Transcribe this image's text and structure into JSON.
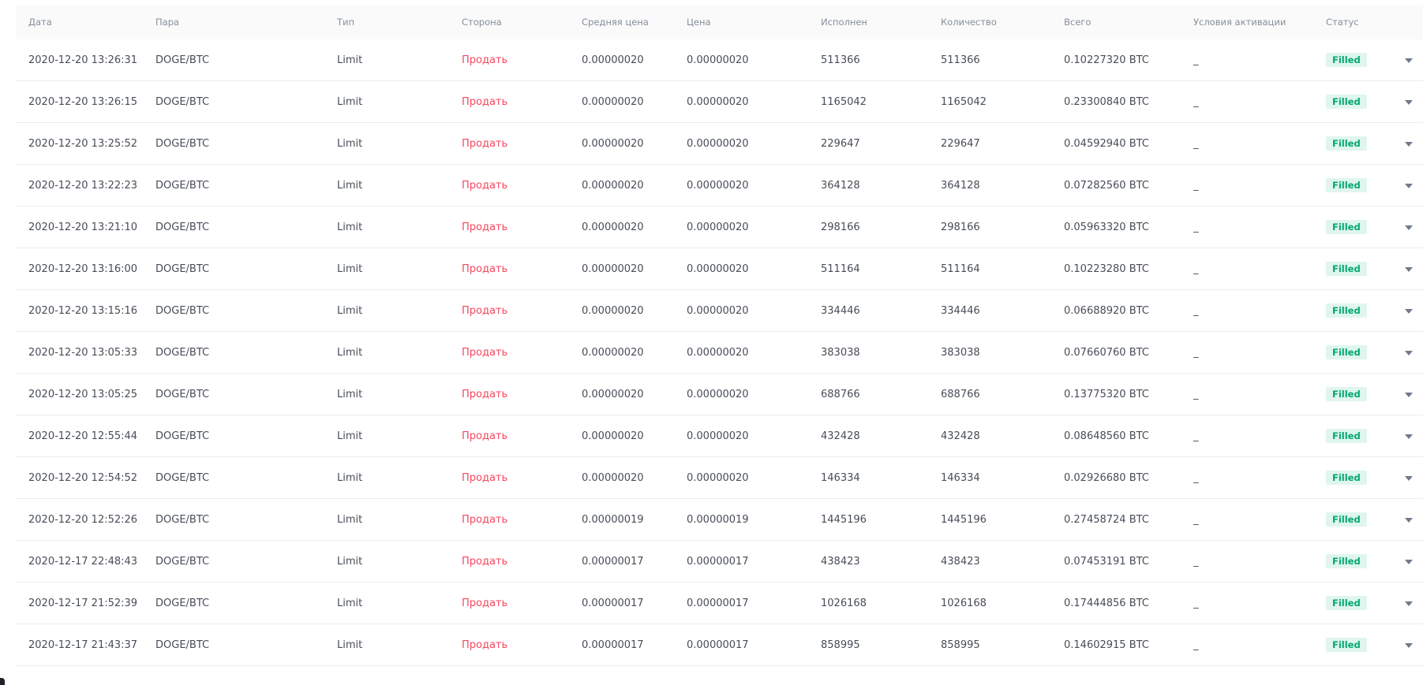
{
  "table": {
    "headers": [
      "Дата",
      "Пара",
      "Тип",
      "Сторона",
      "Средняя цена",
      "Цена",
      "Исполнен",
      "Количество",
      "Всего",
      "Условия активации",
      "Статус"
    ],
    "rows": [
      {
        "date": "2020-12-20 13:26:31",
        "pair": "DOGE/BTC",
        "type": "Limit",
        "side": "Продать",
        "avg_price": "0.00000020",
        "price": "0.00000020",
        "filled": "511366",
        "amount": "511366",
        "total": "0.10227320 BTC",
        "condition": "_",
        "status": "Filled"
      },
      {
        "date": "2020-12-20 13:26:15",
        "pair": "DOGE/BTC",
        "type": "Limit",
        "side": "Продать",
        "avg_price": "0.00000020",
        "price": "0.00000020",
        "filled": "1165042",
        "amount": "1165042",
        "total": "0.23300840 BTC",
        "condition": "_",
        "status": "Filled"
      },
      {
        "date": "2020-12-20 13:25:52",
        "pair": "DOGE/BTC",
        "type": "Limit",
        "side": "Продать",
        "avg_price": "0.00000020",
        "price": "0.00000020",
        "filled": "229647",
        "amount": "229647",
        "total": "0.04592940 BTC",
        "condition": "_",
        "status": "Filled"
      },
      {
        "date": "2020-12-20 13:22:23",
        "pair": "DOGE/BTC",
        "type": "Limit",
        "side": "Продать",
        "avg_price": "0.00000020",
        "price": "0.00000020",
        "filled": "364128",
        "amount": "364128",
        "total": "0.07282560 BTC",
        "condition": "_",
        "status": "Filled"
      },
      {
        "date": "2020-12-20 13:21:10",
        "pair": "DOGE/BTC",
        "type": "Limit",
        "side": "Продать",
        "avg_price": "0.00000020",
        "price": "0.00000020",
        "filled": "298166",
        "amount": "298166",
        "total": "0.05963320 BTC",
        "condition": "_",
        "status": "Filled"
      },
      {
        "date": "2020-12-20 13:16:00",
        "pair": "DOGE/BTC",
        "type": "Limit",
        "side": "Продать",
        "avg_price": "0.00000020",
        "price": "0.00000020",
        "filled": "511164",
        "amount": "511164",
        "total": "0.10223280 BTC",
        "condition": "_",
        "status": "Filled"
      },
      {
        "date": "2020-12-20 13:15:16",
        "pair": "DOGE/BTC",
        "type": "Limit",
        "side": "Продать",
        "avg_price": "0.00000020",
        "price": "0.00000020",
        "filled": "334446",
        "amount": "334446",
        "total": "0.06688920 BTC",
        "condition": "_",
        "status": "Filled"
      },
      {
        "date": "2020-12-20 13:05:33",
        "pair": "DOGE/BTC",
        "type": "Limit",
        "side": "Продать",
        "avg_price": "0.00000020",
        "price": "0.00000020",
        "filled": "383038",
        "amount": "383038",
        "total": "0.07660760 BTC",
        "condition": "_",
        "status": "Filled"
      },
      {
        "date": "2020-12-20 13:05:25",
        "pair": "DOGE/BTC",
        "type": "Limit",
        "side": "Продать",
        "avg_price": "0.00000020",
        "price": "0.00000020",
        "filled": "688766",
        "amount": "688766",
        "total": "0.13775320 BTC",
        "condition": "_",
        "status": "Filled"
      },
      {
        "date": "2020-12-20 12:55:44",
        "pair": "DOGE/BTC",
        "type": "Limit",
        "side": "Продать",
        "avg_price": "0.00000020",
        "price": "0.00000020",
        "filled": "432428",
        "amount": "432428",
        "total": "0.08648560 BTC",
        "condition": "_",
        "status": "Filled"
      },
      {
        "date": "2020-12-20 12:54:52",
        "pair": "DOGE/BTC",
        "type": "Limit",
        "side": "Продать",
        "avg_price": "0.00000020",
        "price": "0.00000020",
        "filled": "146334",
        "amount": "146334",
        "total": "0.02926680 BTC",
        "condition": "_",
        "status": "Filled"
      },
      {
        "date": "2020-12-20 12:52:26",
        "pair": "DOGE/BTC",
        "type": "Limit",
        "side": "Продать",
        "avg_price": "0.00000019",
        "price": "0.00000019",
        "filled": "1445196",
        "amount": "1445196",
        "total": "0.27458724 BTC",
        "condition": "_",
        "status": "Filled"
      },
      {
        "date": "2020-12-17 22:48:43",
        "pair": "DOGE/BTC",
        "type": "Limit",
        "side": "Продать",
        "avg_price": "0.00000017",
        "price": "0.00000017",
        "filled": "438423",
        "amount": "438423",
        "total": "0.07453191 BTC",
        "condition": "_",
        "status": "Filled"
      },
      {
        "date": "2020-12-17 21:52:39",
        "pair": "DOGE/BTC",
        "type": "Limit",
        "side": "Продать",
        "avg_price": "0.00000017",
        "price": "0.00000017",
        "filled": "1026168",
        "amount": "1026168",
        "total": "0.17444856 BTC",
        "condition": "_",
        "status": "Filled"
      },
      {
        "date": "2020-12-17 21:43:37",
        "pair": "DOGE/BTC",
        "type": "Limit",
        "side": "Продать",
        "avg_price": "0.00000017",
        "price": "0.00000017",
        "filled": "858995",
        "amount": "858995",
        "total": "0.14602915 BTC",
        "condition": "_",
        "status": "Filled"
      }
    ]
  },
  "colors": {
    "sell": "#f6465d",
    "status_bg": "#dff6ee",
    "status_text": "#03a66d",
    "header_bg": "#fafafa"
  },
  "icons": {
    "row_expand": "caret-down-icon"
  }
}
